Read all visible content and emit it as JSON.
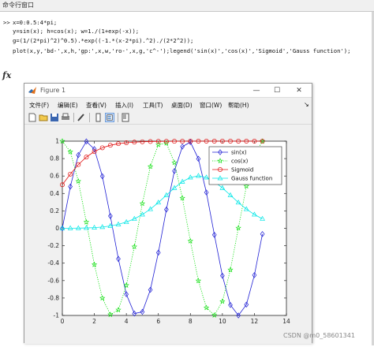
{
  "window": {
    "title": "命令行窗口"
  },
  "command_window": {
    "lines": [
      "x=0:0.5:4*pi;",
      "y=sin(x); h=cos(x); w=1./(1+exp(-x));",
      "g=(1/(2*pi)^2)^0.5).*exp((-1.*(x-2*pi).^2)./(2*2^2));",
      "plot(x,y,'bd-',x,h,'gp:',x,w,'ro-',x,g,'c^-');legend('sin(x)','cos(x)','Sigmoid','Gauss function');"
    ],
    "prompt": ">>",
    "fx_symbol": "fx"
  },
  "figure": {
    "title": "Figure 1",
    "menu": [
      "文件(F)",
      "编辑(E)",
      "查看(V)",
      "插入(I)",
      "工具(T)",
      "桌面(D)",
      "窗口(W)",
      "帮助(H)"
    ],
    "window_buttons": {
      "minimize": "—",
      "maximize": "☐",
      "close": "✕"
    },
    "toolbar_icons": [
      "new-figure-icon",
      "open-icon",
      "save-icon",
      "print-icon",
      "edit-plot-icon",
      "insert-colorbar-icon",
      "insert-legend-icon",
      "data-cursor-icon"
    ]
  },
  "chart_data": {
    "type": "line",
    "xlim": [
      0,
      14
    ],
    "ylim": [
      -1,
      1
    ],
    "x_ticks": [
      0,
      2,
      4,
      6,
      8,
      10,
      12,
      14
    ],
    "y_ticks": [
      -1,
      -0.8,
      -0.6,
      -0.4,
      -0.2,
      0,
      0.2,
      0.4,
      0.6,
      0.8,
      1
    ],
    "grid": false,
    "legend_position": "top-right",
    "x": [
      0,
      0.5,
      1,
      1.5,
      2,
      2.5,
      3,
      3.5,
      4,
      4.5,
      5,
      5.5,
      6,
      6.5,
      7,
      7.5,
      8,
      8.5,
      9,
      9.5,
      10,
      10.5,
      11,
      11.5,
      12,
      12.5
    ],
    "series": [
      {
        "name": "sin(x)",
        "color": "#1f1fd4",
        "marker": "diamond",
        "line": "solid",
        "values": [
          0,
          0.479,
          0.841,
          0.997,
          0.909,
          0.598,
          0.141,
          -0.351,
          -0.757,
          -0.978,
          -0.959,
          -0.706,
          -0.279,
          0.215,
          0.657,
          0.938,
          0.989,
          0.798,
          0.412,
          -0.075,
          -0.544,
          -0.88,
          -1.0,
          -0.875,
          -0.537,
          -0.066
        ]
      },
      {
        "name": "cos(x)",
        "color": "#00dd00",
        "marker": "pentagram",
        "line": "dotted",
        "values": [
          1,
          0.878,
          0.54,
          0.071,
          -0.416,
          -0.801,
          -0.99,
          -0.936,
          -0.654,
          -0.211,
          0.284,
          0.709,
          0.96,
          0.977,
          0.754,
          0.347,
          -0.146,
          -0.602,
          -0.911,
          -0.997,
          -0.839,
          -0.476,
          0.004,
          0.484,
          0.844,
          0.998
        ]
      },
      {
        "name": "Sigmoid",
        "color": "#e01010",
        "marker": "circle",
        "line": "solid",
        "values": [
          0.5,
          0.622,
          0.731,
          0.818,
          0.881,
          0.924,
          0.953,
          0.971,
          0.982,
          0.989,
          0.993,
          0.996,
          0.998,
          0.998,
          0.999,
          0.999,
          1.0,
          1.0,
          1.0,
          1.0,
          1.0,
          1.0,
          1.0,
          1.0,
          1.0,
          1.0
        ]
      },
      {
        "name": "Gauss function",
        "color": "#00e6e6",
        "marker": "triangle",
        "line": "solid",
        "values": [
          0.0,
          0.001,
          0.002,
          0.004,
          0.008,
          0.015,
          0.027,
          0.045,
          0.072,
          0.109,
          0.158,
          0.22,
          0.296,
          0.38,
          0.463,
          0.535,
          0.584,
          0.602,
          0.584,
          0.535,
          0.463,
          0.38,
          0.296,
          0.22,
          0.158,
          0.109
        ]
      }
    ]
  },
  "watermark": "CSDN @m0_58601341"
}
